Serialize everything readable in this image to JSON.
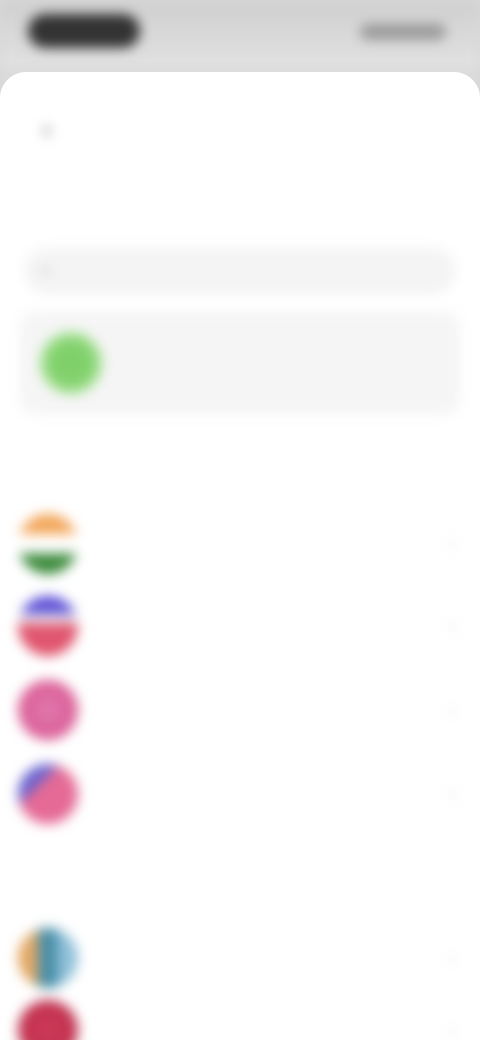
{
  "screen": {
    "title": "",
    "search_placeholder": "",
    "current_country": "",
    "section_all": "",
    "section_more": ""
  },
  "icons": {
    "back": "arrow-left-icon",
    "search": "search-icon",
    "chevron": "chevron-right-icon"
  },
  "countries": [
    {
      "name": ""
    },
    {
      "name": ""
    },
    {
      "name": ""
    },
    {
      "name": ""
    },
    {
      "name": ""
    },
    {
      "name": ""
    }
  ],
  "colors": {
    "sheet_bg": "#ffffff",
    "current_flag": "#7fd06a",
    "status_bg": "#d9d9d9"
  }
}
